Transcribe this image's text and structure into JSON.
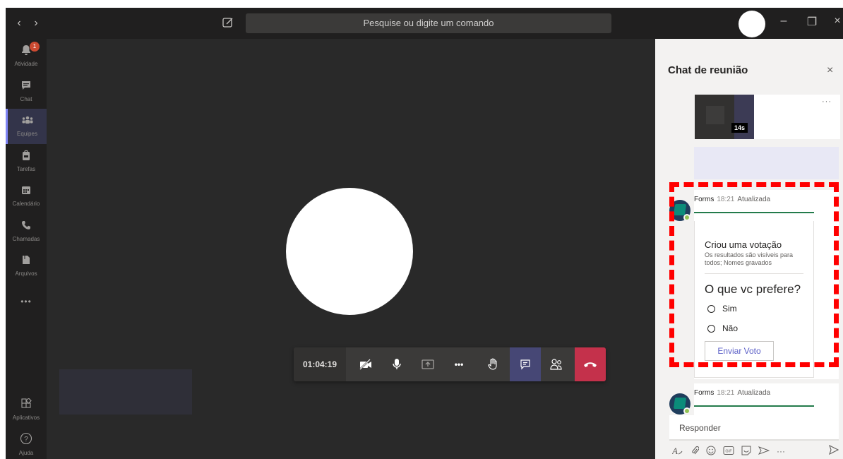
{
  "topbar": {
    "search_placeholder": "Pesquise ou digite um comando",
    "back_icon": "chevron-left",
    "forward_icon": "chevron-right",
    "minimize_glyph": "–",
    "maximize_glyph": "❐",
    "close_glyph": "×"
  },
  "rail": {
    "items": [
      {
        "label": "Atividade",
        "icon": "bell-icon",
        "badge": "1"
      },
      {
        "label": "Chat",
        "icon": "chat-icon"
      },
      {
        "label": "Equipes",
        "icon": "teams-icon",
        "active": true
      },
      {
        "label": "Tarefas",
        "icon": "briefcase-icon"
      },
      {
        "label": "Calendário",
        "icon": "calendar-icon"
      },
      {
        "label": "Chamadas",
        "icon": "phone-icon"
      },
      {
        "label": "Arquivos",
        "icon": "file-icon"
      }
    ],
    "more_glyph": "•••",
    "apps_label": "Aplicativos",
    "help_label": "Ajuda"
  },
  "call": {
    "timer": "01:04:19",
    "more_glyph": "•••"
  },
  "chat_panel": {
    "title": "Chat de reunião",
    "close_glyph": "×",
    "video_duration": "14s",
    "video_more": "···",
    "messages": [
      {
        "sender": "Forms",
        "time": "18:21",
        "status": "Atualizada",
        "poll_heading": "Criou uma votação",
        "poll_sub": "Os resultados são visíveis para todos; Nomes gravados",
        "question": "O que vc prefere?",
        "options": [
          "Sim",
          "Não"
        ],
        "vote_button": "Enviar Voto"
      },
      {
        "sender": "Forms",
        "time": "18:21",
        "status": "Atualizada"
      }
    ],
    "composer_placeholder": "Responder",
    "toolbar_more": "···"
  },
  "colors": {
    "accent": "#5b5fc7",
    "hangup": "#c4314b",
    "highlight_dash": "#ff0000",
    "forms_green": "#237b4b"
  }
}
